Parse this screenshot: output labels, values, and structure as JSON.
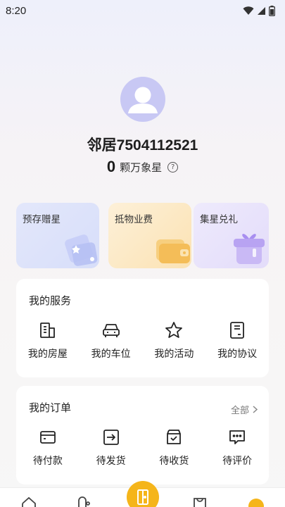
{
  "status_bar": {
    "time": "8:20"
  },
  "profile": {
    "username": "邻居7504112521",
    "stars_count": "0",
    "stars_unit": "颗万象星",
    "help_glyph": "?"
  },
  "promos": [
    {
      "label": "预存赠星"
    },
    {
      "label": "抵物业费"
    },
    {
      "label": "集星兑礼"
    }
  ],
  "services": {
    "title": "我的服务",
    "items": [
      {
        "label": "我的房屋",
        "icon": "building-icon"
      },
      {
        "label": "我的车位",
        "icon": "car-icon"
      },
      {
        "label": "我的活动",
        "icon": "star-icon"
      },
      {
        "label": "我的协议",
        "icon": "document-icon"
      }
    ]
  },
  "orders": {
    "title": "我的订单",
    "view_all": "全部",
    "items": [
      {
        "label": "待付款",
        "icon": "wallet-icon"
      },
      {
        "label": "待发货",
        "icon": "ship-out-icon"
      },
      {
        "label": "待收货",
        "icon": "receive-box-icon"
      },
      {
        "label": "待评价",
        "icon": "comment-icon"
      }
    ]
  },
  "colors": {
    "accent": "#f5b51a",
    "avatar_bg": "#c8c8f4"
  }
}
